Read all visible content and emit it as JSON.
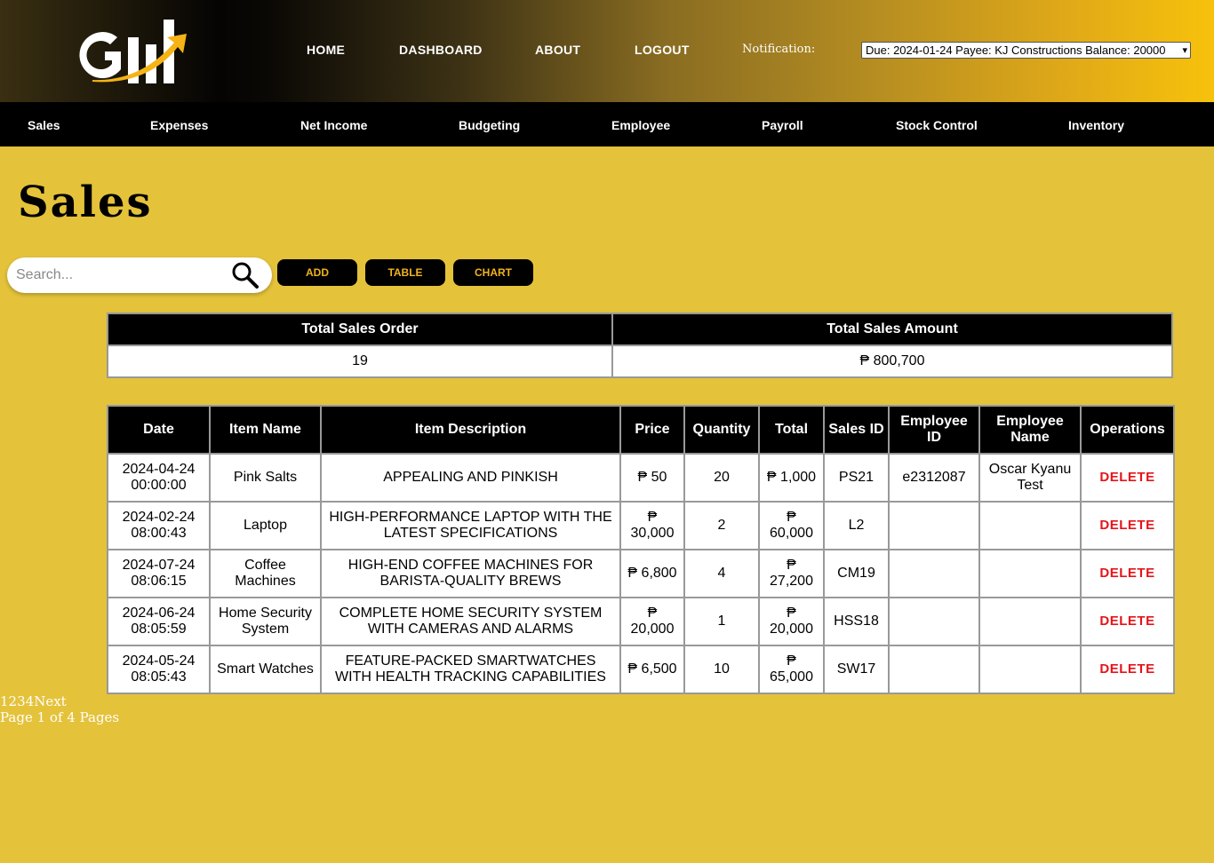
{
  "header": {
    "nav": [
      "HOME",
      "DASHBOARD",
      "ABOUT",
      "LOGOUT"
    ],
    "notification_label": "Notification:",
    "notification_selected": "Due: 2024-01-24 Payee: KJ Constructions Balance: 20000"
  },
  "modules": [
    "Sales",
    "Expenses",
    "Net Income",
    "Budgeting",
    "Employee",
    "Payroll",
    "Stock Control",
    "Inventory"
  ],
  "page_title": "Sales",
  "search": {
    "placeholder": "Search..."
  },
  "buttons": {
    "add": "ADD",
    "table": "TABLE",
    "chart": "CHART"
  },
  "summary": {
    "headers": [
      "Total Sales Order",
      "Total Sales Amount"
    ],
    "values": [
      "19",
      "₱ 800,700"
    ]
  },
  "sales_table": {
    "headers": [
      "Date",
      "Item Name",
      "Item Description",
      "Price",
      "Quantity",
      "Total",
      "Sales ID",
      "Employee ID",
      "Employee Name",
      "Operations"
    ],
    "rows": [
      {
        "date": "2024-04-24 00:00:00",
        "item": "Pink Salts",
        "desc": "APPEALING AND PINKISH",
        "price": "₱ 50",
        "qty": "20",
        "total": "₱ 1,000",
        "sid": "PS21",
        "eid": "e2312087",
        "ename": "Oscar Kyanu Test",
        "op": "DELETE"
      },
      {
        "date": "2024-02-24 08:00:43",
        "item": "Laptop",
        "desc": "HIGH-PERFORMANCE LAPTOP WITH THE LATEST SPECIFICATIONS",
        "price": "₱ 30,000",
        "qty": "2",
        "total": "₱ 60,000",
        "sid": "L2",
        "eid": "",
        "ename": "",
        "op": "DELETE"
      },
      {
        "date": "2024-07-24 08:06:15",
        "item": "Coffee Machines",
        "desc": "HIGH-END COFFEE MACHINES FOR BARISTA-QUALITY BREWS",
        "price": "₱ 6,800",
        "qty": "4",
        "total": "₱ 27,200",
        "sid": "CM19",
        "eid": "",
        "ename": "",
        "op": "DELETE"
      },
      {
        "date": "2024-06-24 08:05:59",
        "item": "Home Security System",
        "desc": "COMPLETE HOME SECURITY SYSTEM WITH CAMERAS AND ALARMS",
        "price": "₱ 20,000",
        "qty": "1",
        "total": "₱ 20,000",
        "sid": "HSS18",
        "eid": "",
        "ename": "",
        "op": "DELETE"
      },
      {
        "date": "2024-05-24 08:05:43",
        "item": "Smart Watches",
        "desc": "FEATURE-PACKED SMARTWATCHES WITH HEALTH TRACKING CAPABILITIES",
        "price": "₱ 6,500",
        "qty": "10",
        "total": "₱ 65,000",
        "sid": "SW17",
        "eid": "",
        "ename": "",
        "op": "DELETE"
      }
    ]
  },
  "pagination": {
    "pages": [
      "1",
      "2",
      "3",
      "4"
    ],
    "next": "Next",
    "status": "Page 1 of 4 Pages"
  }
}
